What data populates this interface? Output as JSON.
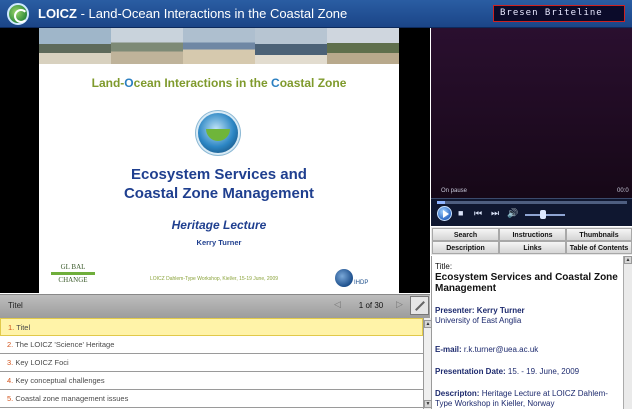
{
  "header": {
    "brand": "LOICZ",
    "title_rest": " - Land-Ocean Interactions in the Coastal Zone",
    "speaker_box": "Bresen Briteline"
  },
  "slide": {
    "heading_pre": "Land-",
    "heading_o": "O",
    "heading_mid": "cean Interactions in the ",
    "heading_c": "C",
    "heading_post": "oastal Zone",
    "title_line1": "Ecosystem Services and",
    "title_line2": "Coastal Zone Management",
    "subtitle": "Heritage Lecture",
    "author": "Kerry Turner",
    "logo_left_top": "GL BAL",
    "logo_left_bottom": "CHANGE",
    "footer": "LOICZ Dahlem-Type Workshop, Kiel/er, 15-19 June, 2009",
    "logo_right": "IHDP"
  },
  "player": {
    "status": "On pause",
    "time": "00:0",
    "stop": "■",
    "prev": "⏮",
    "next": "⏭",
    "volume": "🔊"
  },
  "tabs": {
    "search": "Search",
    "instructions": "Instructions",
    "thumbnails": "Thumbnails",
    "description": "Description",
    "links": "Links",
    "toc": "Table of Contents"
  },
  "info": {
    "title_label": "Title:",
    "title_value": "Ecosystem Services and Coastal Zone Management",
    "presenter_label": "Presenter: Kerry Turner",
    "affiliation": "University of East Anglia",
    "email_label": "E-mail:",
    "email_value": "r.k.turner@uea.ac.uk",
    "date_label": "Presentation Date:",
    "date_value": "15. - 19. June, 2009",
    "desc_label": "Descripton:",
    "desc_value_1": "Heritage Lecture at LOICZ Dahlem-",
    "desc_value_2": "Type Workshop in Kieller, Norway"
  },
  "navbar": {
    "label": "Titel",
    "prev": "◁",
    "page": "1 of 30",
    "next": "▷"
  },
  "slides_list": [
    {
      "num": "1.",
      "text": "Titel"
    },
    {
      "num": "2.",
      "text": "The LOICZ 'Science' Heritage"
    },
    {
      "num": "3.",
      "text": "Key LOICZ Foci"
    },
    {
      "num": "4.",
      "text": "Key conceptual challenges"
    },
    {
      "num": "5.",
      "text": "Coastal zone management issues"
    }
  ],
  "colors": {
    "titlebar": "#2a5da3",
    "active_row": "#fff3a8",
    "slide_title": "#1f3f8f",
    "heading_green": "#7f9a2c"
  }
}
